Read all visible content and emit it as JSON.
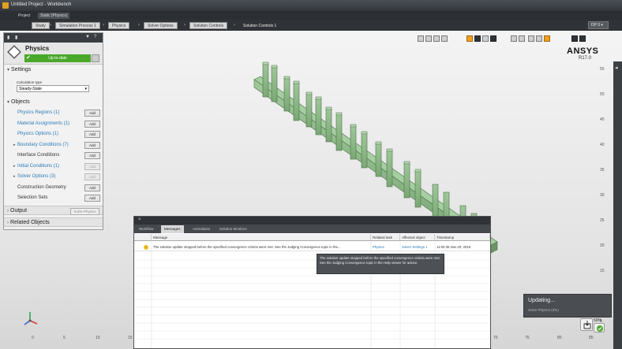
{
  "window": {
    "title": "Untitled Project - Workbench"
  },
  "tabs": [
    {
      "label": "Project"
    },
    {
      "label": "Static (Physics)"
    }
  ],
  "breadcrumbs": [
    "Study",
    "Simulation Process 1",
    "Physics",
    "Solver Options",
    "Solution Controls",
    "Solution Controls 1"
  ],
  "top_right": {
    "slider_label": "DP 0"
  },
  "logo": {
    "name": "ANSYS",
    "release": "R17.0"
  },
  "panel": {
    "title": "Physics",
    "status": "Up-to-date",
    "sections": {
      "settings": "Settings",
      "objects": "Objects",
      "output": "Output",
      "related": "Related Objects"
    },
    "calc_type_label": "Calculation type",
    "calc_type_value": "Steady-State",
    "objects": [
      {
        "label": "Physics Regions (1)",
        "link": true,
        "expand": false,
        "add": "Add"
      },
      {
        "label": "Material Assignments (1)",
        "link": true,
        "expand": false,
        "add": "Add"
      },
      {
        "label": "Physics Options (1)",
        "link": true,
        "expand": false,
        "add": "Add"
      },
      {
        "label": "Boundary Conditions (7)",
        "link": true,
        "expand": true,
        "add": "Add"
      },
      {
        "label": "Interface Conditions",
        "link": false,
        "expand": false,
        "add": "Add"
      },
      {
        "label": "Initial Conditions (1)",
        "link": true,
        "expand": true,
        "add": "Add"
      },
      {
        "label": "Solver Options (3)",
        "link": true,
        "expand": true,
        "add": "Add"
      },
      {
        "label": "Construction Geometry",
        "link": false,
        "expand": false,
        "add": "Add"
      },
      {
        "label": "Selection Sets",
        "link": false,
        "expand": false,
        "add": "Add"
      }
    ],
    "output_button": "Solve Physics"
  },
  "messages": {
    "tabs": [
      "Workflow",
      "Messages",
      "Animations",
      "Solution Monitors"
    ],
    "active_tab": 1,
    "columns": [
      "Message",
      "Related task",
      "Affected object",
      "Timestamp"
    ],
    "rows": [
      {
        "message": "The solution update stopped before the specified convergence criteria were met. See the Judging Convergence topic in the...",
        "task": "Physics",
        "object": "Solver Settings 1",
        "time": "11:02:36 Nov 20, 2015"
      }
    ],
    "tooltip": "The solution update stopped before the specified convergence criteria were met. See the Judging Convergence topic in the Help viewer for advice."
  },
  "updating": {
    "title": "Updating...",
    "subtitle": "Solve Physics (3%)"
  },
  "progress": {
    "label": "50%"
  },
  "axis": {
    "vertical": [
      "55",
      "50",
      "45",
      "40",
      "35",
      "30",
      "25",
      "20",
      "15",
      "10",
      "5"
    ],
    "horizontal": [
      "0",
      "5",
      "10",
      "15",
      "70",
      "75",
      "80",
      "85"
    ]
  },
  "colors": {
    "model": "#8fb98a",
    "status_ok": "#4aa82a",
    "accent": "#2a7ab8"
  }
}
